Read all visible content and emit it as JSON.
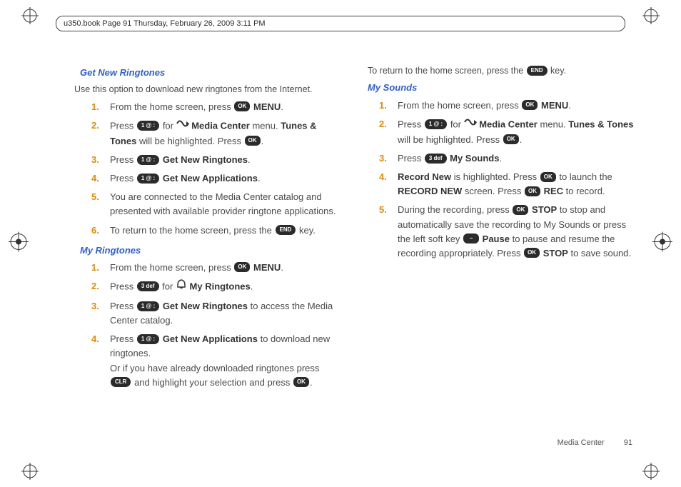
{
  "header": {
    "text": "u350.book  Page 91  Thursday, February 26, 2009  3:11 PM"
  },
  "footer": {
    "section": "Media Center",
    "page": "91"
  },
  "keys": {
    "ok": "OK",
    "one": "1 @ :",
    "three": "3 def",
    "end": "END",
    "clr": "CLR",
    "pause": "–"
  },
  "left": {
    "sec1": {
      "title": "Get New Ringtones",
      "intro": "Use this option to download new ringtones from the Internet.",
      "s1_a": "From the home screen, press ",
      "s1_b": " MENU",
      "s1_c": ".",
      "s2_a": "Press ",
      "s2_b": " for ",
      "s2_c": " Media Center",
      "s2_d": " menu. ",
      "s2_e": "Tunes & Tones",
      "s2_f": " will be highlighted. Press ",
      "s2_g": ".",
      "s3_a": "Press ",
      "s3_b": " Get New Ringtones",
      "s3_c": ".",
      "s4_a": "Press ",
      "s4_b": " Get New Applications",
      "s4_c": ".",
      "s5": "You are connected to the Media Center catalog and presented with available provider ringtone applications.",
      "s6_a": "To return to the home screen, press the ",
      "s6_b": " key."
    },
    "sec2": {
      "title": "My Ringtones",
      "s1_a": "From the home screen, press ",
      "s1_b": " MENU",
      "s1_c": ".",
      "s2_a": "Press ",
      "s2_b": " for ",
      "s2_c": " My Ringtones",
      "s2_d": ".",
      "s3_a": "Press ",
      "s3_b": " Get New Ringtones",
      "s3_c": " to access the Media Center catalog.",
      "s4_a": "Press ",
      "s4_b": " Get New Applications",
      "s4_c": " to download new ringtones.",
      "s4_d": "Or if you have already downloaded ringtones press ",
      "s4_e": " and highlight your selection and press ",
      "s4_f": "."
    }
  },
  "right": {
    "intro_a": "To return to the home screen, press the ",
    "intro_b": " key.",
    "sec1": {
      "title": "My Sounds",
      "s1_a": "From the home screen, press ",
      "s1_b": " MENU",
      "s1_c": ".",
      "s2_a": "Press ",
      "s2_b": " for ",
      "s2_c": " Media Center",
      "s2_d": " menu. ",
      "s2_e": "Tunes & Tones",
      "s2_f": " will be highlighted. Press ",
      "s2_g": ".",
      "s3_a": "Press ",
      "s3_b": " My Sounds",
      "s3_c": ".",
      "s4_a": "Record New",
      "s4_b": " is highlighted. Press ",
      "s4_c": " to launch the ",
      "s4_d": "RECORD NEW",
      "s4_e": " screen. Press ",
      "s4_f": " REC",
      "s4_g": " to record.",
      "s5_a": "During the recording,  press ",
      "s5_b": " STOP",
      "s5_c": " to stop and automatically save the recording to My Sounds or press the left soft key ",
      "s5_d": " Pause",
      "s5_e": " to pause and resume the recording appropriately. Press ",
      "s5_f": " STOP",
      "s5_g": " to save sound."
    }
  }
}
